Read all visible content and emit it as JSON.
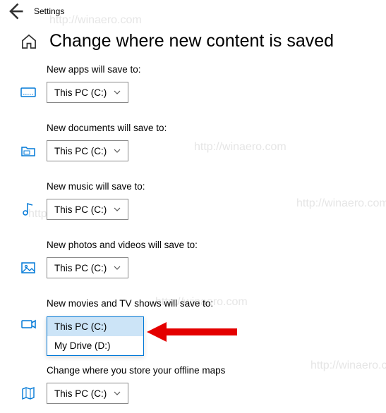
{
  "titlebar": {
    "app_name": "Settings"
  },
  "page": {
    "title": "Change where new content is saved"
  },
  "sections": {
    "apps": {
      "label": "New apps will save to:",
      "value": "This PC (C:)"
    },
    "documents": {
      "label": "New documents will save to:",
      "value": "This PC (C:)"
    },
    "music": {
      "label": "New music will save to:",
      "value": "This PC (C:)"
    },
    "photos": {
      "label": "New photos and videos will save to:",
      "value": "This PC (C:)"
    },
    "movies": {
      "label": "New movies and TV shows will save to:",
      "options": [
        "This PC (C:)",
        "My Drive (D:)"
      ],
      "selected": "This PC (C:)"
    },
    "maps": {
      "label": "Change where you store your offline maps",
      "value": "This PC (C:)"
    }
  },
  "watermark": "http://winaero.com"
}
